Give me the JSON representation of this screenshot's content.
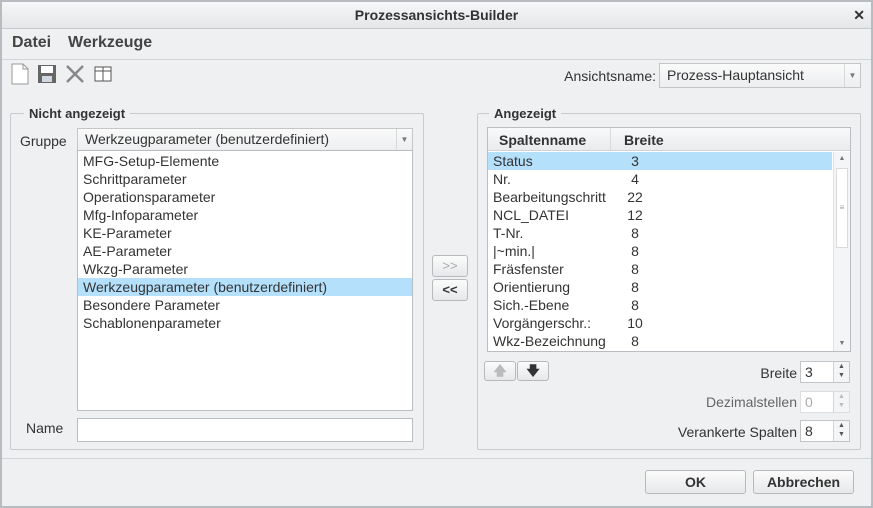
{
  "title": "Prozessansichts-Builder",
  "menu": [
    "Datei",
    "Werkzeuge"
  ],
  "view_name": {
    "label": "Ansichtsname:",
    "value": "Prozess-Hauptansicht"
  },
  "left": {
    "title": "Nicht angezeigt",
    "group_label": "Gruppe",
    "group_value": "Werkzeugparameter (benutzerdefiniert)",
    "items": [
      "MFG-Setup-Elemente",
      "Schrittparameter",
      "Operationsparameter",
      "Mfg-Infoparameter",
      "KE-Parameter",
      "AE-Parameter",
      "Wkzg-Parameter",
      "Werkzeugparameter (benutzerdefiniert)",
      "Besondere Parameter",
      "Schablonenparameter"
    ],
    "selected_index": 7,
    "name_label": "Name",
    "name_value": ""
  },
  "transfer": {
    "add": ">>",
    "remove": "<<"
  },
  "right": {
    "title": "Angezeigt",
    "col_name": "Spaltenname",
    "col_width": "Breite",
    "rows": [
      {
        "name": "Status",
        "width": "3"
      },
      {
        "name": "Nr.",
        "width": "4"
      },
      {
        "name": "Bearbeitungschritt",
        "width": "22"
      },
      {
        "name": "NCL_DATEI",
        "width": "12"
      },
      {
        "name": "T-Nr.",
        "width": "8"
      },
      {
        "name": "|~min.|",
        "width": "8"
      },
      {
        "name": "Fräsfenster",
        "width": "8"
      },
      {
        "name": "Orientierung",
        "width": "8"
      },
      {
        "name": "Sich.-Ebene",
        "width": "8"
      },
      {
        "name": "Vorgängerschr.:",
        "width": "10"
      },
      {
        "name": "Wkz-Bezeichnung",
        "width": "8"
      }
    ],
    "width_label": "Breite",
    "width_value": "3",
    "decimals_label": "Dezimalstellen",
    "decimals_value": "0",
    "anchored_label": "Verankerte Spalten",
    "anchored_value": "8"
  },
  "buttons": {
    "ok": "OK",
    "cancel": "Abbrechen"
  }
}
